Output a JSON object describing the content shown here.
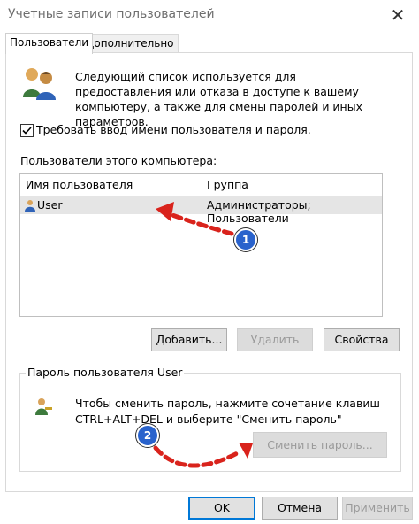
{
  "window": {
    "title": "Учетные записи пользователей"
  },
  "tabs": [
    "Пользователи",
    "Дополнительно"
  ],
  "intro_text": "Следующий список используется для предоставления или отказа в доступе к вашему компьютеру, а также для смены паролей и иных параметров.",
  "require_login": {
    "label": "Требовать ввод имени пользователя и пароля.",
    "checked": true
  },
  "users_label": "Пользователи этого компьютера:",
  "list": {
    "columns": [
      "Имя пользователя",
      "Группа"
    ],
    "rows": [
      {
        "name": "User",
        "group": "Администраторы; Пользователи"
      }
    ]
  },
  "buttons": {
    "add": "Добавить...",
    "remove": "Удалить",
    "properties": "Свойства"
  },
  "password_group": {
    "title": "Пароль пользователя User",
    "text_line1": "Чтобы сменить пароль, нажмите сочетание клавиш",
    "text_line2": "CTRL+ALT+DEL и выберите \"Сменить пароль\"",
    "change_button": "Сменить пароль..."
  },
  "dialog_buttons": {
    "ok": "OK",
    "cancel": "Отмена",
    "apply": "Применить"
  },
  "annotations": {
    "step1": "1",
    "step2": "2"
  },
  "colors": {
    "arrow_red": "#d9231c",
    "badge_blue": "#2962cc",
    "accent_blue": "#0078d7"
  }
}
